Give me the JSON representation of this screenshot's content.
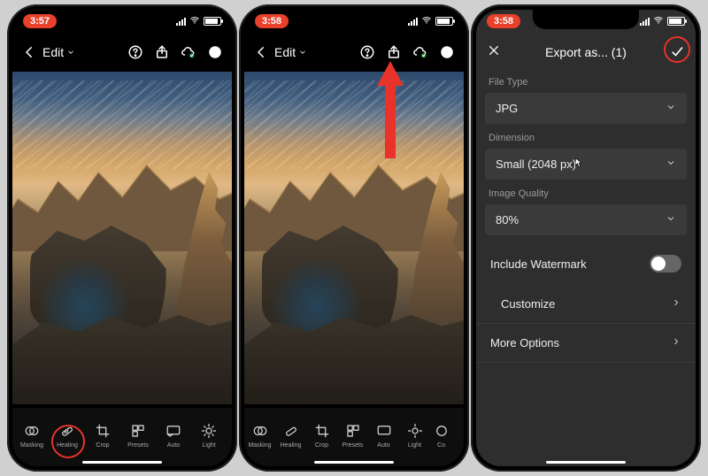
{
  "phone1": {
    "clock": "3:57",
    "header": {
      "edit_label": "Edit"
    },
    "tools": [
      {
        "id": "masking",
        "label": "Masking"
      },
      {
        "id": "healing",
        "label": "Healing"
      },
      {
        "id": "crop",
        "label": "Crop"
      },
      {
        "id": "presets",
        "label": "Presets"
      },
      {
        "id": "auto",
        "label": "Auto"
      },
      {
        "id": "light",
        "label": "Light"
      }
    ]
  },
  "phone2": {
    "clock": "3:58",
    "header": {
      "edit_label": "Edit"
    },
    "tools": [
      {
        "id": "masking",
        "label": "Masking"
      },
      {
        "id": "healing",
        "label": "Healing"
      },
      {
        "id": "crop",
        "label": "Crop"
      },
      {
        "id": "presets",
        "label": "Presets"
      },
      {
        "id": "auto",
        "label": "Auto"
      },
      {
        "id": "light",
        "label": "Light"
      },
      {
        "id": "color",
        "label": "Co"
      }
    ]
  },
  "phone3": {
    "clock": "3:58",
    "export": {
      "title": "Export as... (1)",
      "file_type_label": "File Type",
      "file_type_value": "JPG",
      "dimension_label": "Dimension",
      "dimension_value": "Small (2048 px)",
      "image_quality_label": "Image Quality",
      "image_quality_value": "80%",
      "include_watermark_label": "Include Watermark",
      "customize_label": "Customize",
      "more_options_label": "More Options"
    }
  }
}
